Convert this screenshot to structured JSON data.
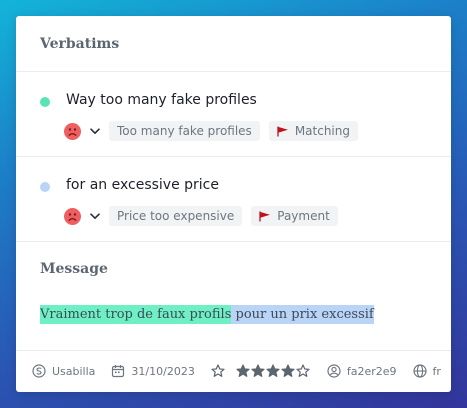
{
  "header": {
    "title": "Verbatims"
  },
  "verbatims": [
    {
      "text": "Way too many fake profiles",
      "sentiment_icon": "sad-face-icon",
      "topic": "Too many fake profiles",
      "category": "Matching",
      "dot_color": "#5be3b4"
    },
    {
      "text": "for an excessive price",
      "sentiment_icon": "sad-face-icon",
      "topic": "Price too expensive",
      "category": "Payment",
      "dot_color": "#b9d4f7"
    }
  ],
  "message": {
    "title": "Message",
    "segments": [
      {
        "text": "Vraiment trop de faux profils",
        "color": "#6ef0c4"
      },
      {
        "text": " pour un prix excessif",
        "color": "#b9d4f7"
      }
    ]
  },
  "footer": {
    "source": "Usabilla",
    "date": "31/10/2023",
    "rating": 4,
    "rating_max": 5,
    "user_id": "fa2er2e9",
    "language": "fr"
  },
  "colors": {
    "sad": "#ef5f62",
    "flag": "#c0141c",
    "star": "#5c6670"
  }
}
